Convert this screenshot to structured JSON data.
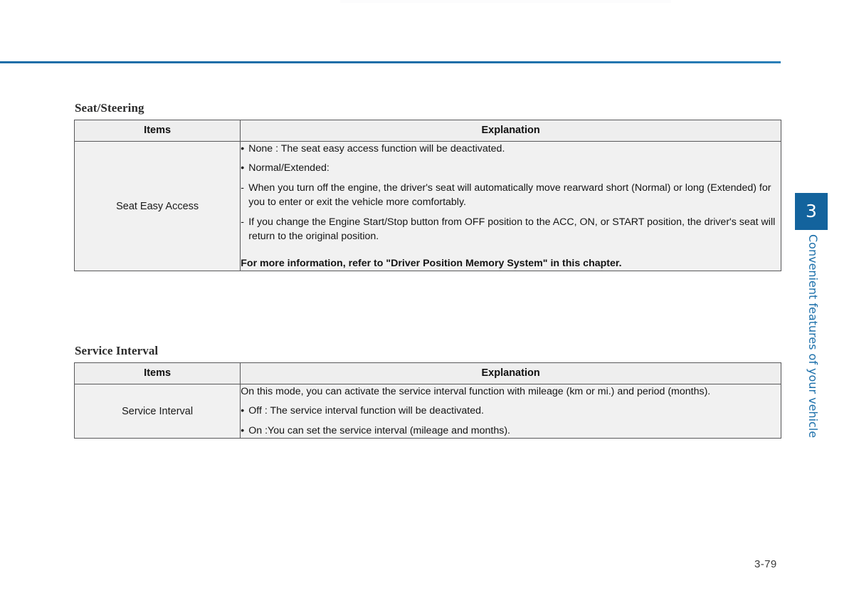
{
  "page": {
    "number": "3-79",
    "accent_color": "#13639d",
    "rule_color": "#1d6ea8"
  },
  "chapter_tab": {
    "number": "3",
    "label": "Convenient features of your vehicle"
  },
  "sections": [
    {
      "heading": "Seat/Steering",
      "table": {
        "headers": {
          "items": "Items",
          "explanation": "Explanation"
        },
        "rows": [
          {
            "item": "Seat Easy Access",
            "lines": [
              {
                "style": "bullet",
                "text": "None : The seat easy access function will be deactivated."
              },
              {
                "style": "bullet",
                "text": "Normal/Extended:"
              },
              {
                "style": "dash",
                "text": "When you turn off the engine, the driver's seat will automatically move rearward short (Normal) or long (Extended) for you to enter or exit the vehicle more comfortably."
              },
              {
                "style": "dash",
                "text": "If you change the Engine Start/Stop button from OFF position to the ACC, ON, or START position, the driver's seat will return to the original position."
              },
              {
                "style": "note",
                "text": "For more information, refer to \"Driver Position Memory System\" in this chapter."
              }
            ]
          }
        ]
      }
    },
    {
      "heading": "Service Interval",
      "table": {
        "headers": {
          "items": "Items",
          "explanation": "Explanation"
        },
        "rows": [
          {
            "item": "Service Interval",
            "lines": [
              {
                "style": "plain-justify",
                "text": "On this mode, you can activate the service interval function with mileage (km or mi.) and period (months)."
              },
              {
                "style": "bullet",
                "text": "Off : The service interval function will be deactivated."
              },
              {
                "style": "bullet",
                "text": "On :You can set the service interval (mileage and months)."
              }
            ]
          }
        ]
      }
    }
  ]
}
